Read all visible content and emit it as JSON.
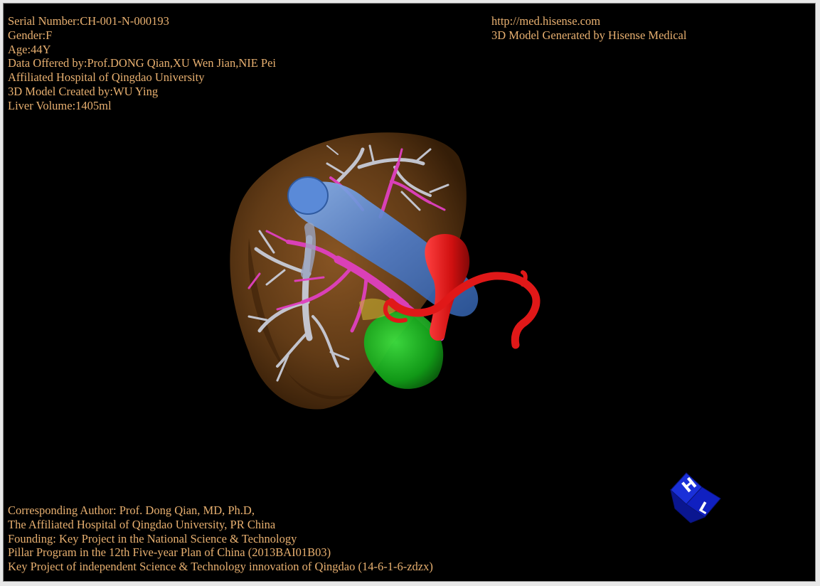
{
  "info_top_left": {
    "serial": "Serial Number:CH-001-N-000193",
    "gender": "Gender:F",
    "age": "Age:44Y",
    "data_offered": "Data Offered by:Prof.DONG Qian,XU Wen Jian,NIE Pei",
    "hospital": "Affiliated Hospital of Qingdao University",
    "model_created": "3D Model Created by:WU Ying",
    "liver_volume": "Liver Volume:1405ml"
  },
  "info_top_right": {
    "url": "http://med.hisense.com",
    "generated_by": "3D Model Generated by Hisense Medical"
  },
  "info_bottom_left": {
    "author": "Corresponding Author: Prof. Dong Qian, MD, Ph.D,",
    "affiliation": "The Affiliated Hospital of Qingdao University, PR China",
    "founding": "Founding: Key Project in the National Science & Technology",
    "program": "Pillar Program in the 12th Five-year Plan of China (2013BAI01B03)",
    "key_project": "Key Project of independent Science & Technology innovation of Qingdao (14-6-1-6-zdzx)"
  },
  "orientation_cube": {
    "face_top": "H",
    "face_side": "L"
  },
  "colors": {
    "text": "#e8b070",
    "background": "#000000",
    "liver": "#7a4a1c",
    "portal_vein": "#6090d8",
    "hepatic_vein": "#c8ccd8",
    "artery_branch": "#e040c0",
    "aorta": "#e01818",
    "gallbladder": "#18b020",
    "cube": "#1020c8"
  }
}
